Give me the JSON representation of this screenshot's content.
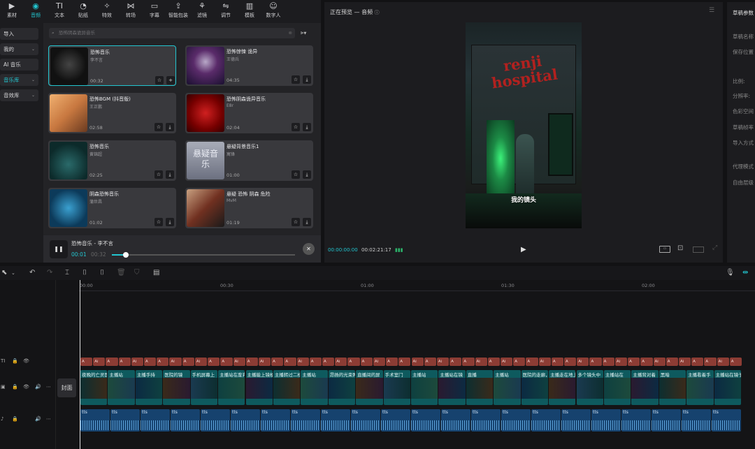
{
  "tabs": [
    {
      "label": "素材",
      "icon": "media-icon"
    },
    {
      "label": "音频",
      "icon": "audio-icon",
      "active": true
    },
    {
      "label": "文本",
      "icon": "text-icon"
    },
    {
      "label": "贴纸",
      "icon": "sticker-icon"
    },
    {
      "label": "特效",
      "icon": "effects-icon"
    },
    {
      "label": "转场",
      "icon": "transition-icon"
    },
    {
      "label": "字幕",
      "icon": "subtitle-icon"
    },
    {
      "label": "智能包装",
      "icon": "smart-pack-icon"
    },
    {
      "label": "滤镜",
      "icon": "filter-icon"
    },
    {
      "label": "调节",
      "icon": "adjust-icon"
    },
    {
      "label": "模板",
      "icon": "template-icon"
    },
    {
      "label": "数字人",
      "icon": "digital-human-icon"
    }
  ],
  "leftnav": [
    {
      "label": "导入"
    },
    {
      "label": "我的",
      "caret": "⌄"
    },
    {
      "label": "AI 音乐"
    },
    {
      "label": "音乐库",
      "caret": "⌄",
      "active": true
    },
    {
      "label": "音效库",
      "caret": "⌄"
    }
  ],
  "search": {
    "placeholder": "恐怖阴森诡异音乐"
  },
  "filter_label": "▼",
  "cards": [
    {
      "title": "恐怖音乐",
      "artist": "李不言",
      "duration": "00:32",
      "selected": true
    },
    {
      "title": "恐怖惊悚 诡异",
      "artist": "王德兵",
      "duration": "04:35"
    },
    {
      "title": "恐怖BGM (抖音版)",
      "artist": "王正鹏",
      "duration": "02:58"
    },
    {
      "title": "恐怖阴森诡异音乐",
      "artist": "E8r",
      "duration": "02:04"
    },
    {
      "title": "恐怖音乐",
      "artist": "黄锦超",
      "duration": "02:25"
    },
    {
      "title": "悬疑背景音乐1",
      "artist": "寓锋",
      "duration": "01:00",
      "thumb_text": "悬疑音乐"
    },
    {
      "title": "阴森恐怖音乐",
      "artist": "蒲世昌",
      "duration": "01:02"
    },
    {
      "title": "悬疑 恐怖 阴森 危险",
      "artist": "MvM",
      "duration": "01:19"
    }
  ],
  "player": {
    "title": "恐怖音乐 - 李不言",
    "current": "00:01",
    "total": "00:32",
    "progress": 0.03
  },
  "preview": {
    "title": "正在预览 — 音频",
    "current": "00:00:00:00",
    "total": "00:02:21:17",
    "caption": "我的镜头",
    "sign": "renji hospital",
    "menu": "☰"
  },
  "draft": {
    "header": "草稿参数",
    "items": [
      "草稿名称",
      "保存位置",
      "比例:",
      "分辨率:",
      "色彩空间",
      "草稿帧率",
      "导入方式",
      "代理模式",
      "自由层级"
    ]
  },
  "timeline": {
    "ruler": [
      "00:00",
      "00:30",
      "01:00",
      "01:30",
      "02:00"
    ],
    "cover_label": "封面",
    "text_seg_labels": [
      "A",
      "Ai",
      "A",
      "A",
      "Ai",
      "A",
      "A",
      "Ai",
      "A",
      "Ai",
      "A",
      "A",
      "Ai",
      "A",
      "Ai",
      "A",
      "A",
      "Ai",
      "A",
      "A",
      "Ai",
      "A",
      "A",
      "Ai",
      "A",
      "A",
      "Ai",
      "A",
      "Ai",
      "A",
      "A",
      "Ai",
      "A",
      "Ai",
      "A",
      "A",
      "Ai",
      "A",
      "A",
      "Ai",
      "A",
      "A",
      "Ai",
      "A",
      "A",
      "Ai",
      "A",
      "Ai",
      "A",
      "A",
      "Ai",
      "A"
    ],
    "video_clips": [
      "夜晚的亡灵医院",
      "主播站",
      "主播手持",
      "医院的镜",
      "手机屏幕上",
      "主播站在废弃医院",
      "主播能上镜楼",
      "主播转过二楼",
      "主播站",
      "昂扬的光束照",
      "直播间的屏",
      "手术室门",
      "主播站",
      "主播站在镜",
      "直播",
      "主播站",
      "医院的走廊，两侧",
      "主播走在地上",
      "多个镜头中",
      "主播站在",
      "主播背对着",
      "黑暗",
      "主播看着手",
      "主播站在镜子前"
    ],
    "audio_clips": [
      "tts",
      "tts",
      "tts",
      "tts",
      "tts",
      "tts",
      "tts",
      "tts",
      "tts",
      "tts",
      "tts",
      "tts",
      "tts",
      "tts",
      "tts",
      "tts",
      "tts",
      "tts",
      "tts",
      "tts",
      "tts",
      "tts"
    ]
  }
}
